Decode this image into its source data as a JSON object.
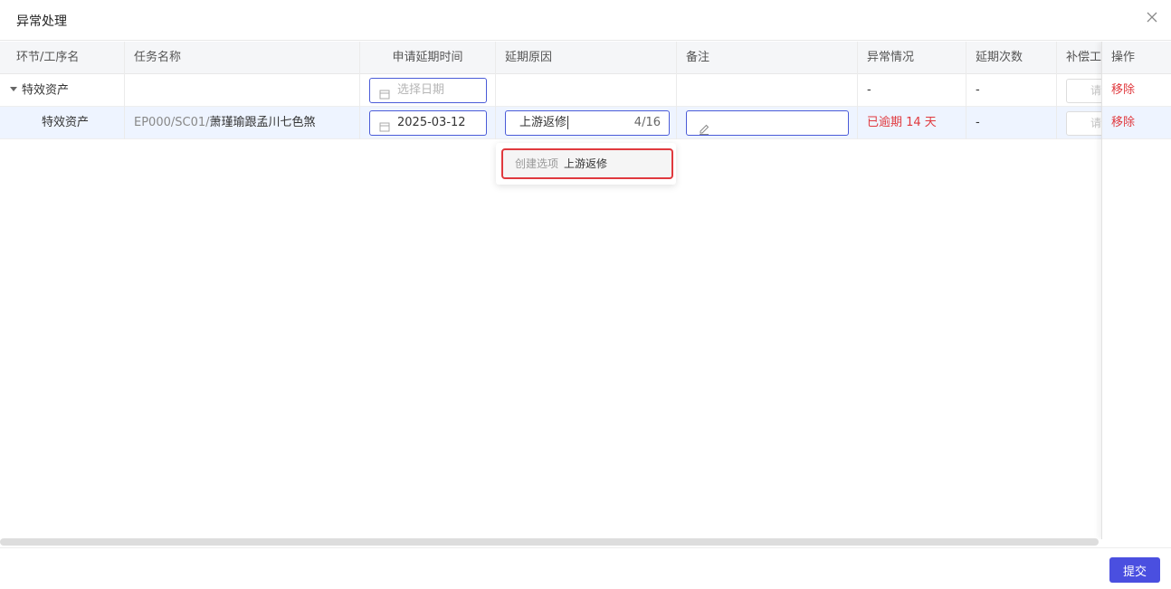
{
  "dialog": {
    "title": "异常处理",
    "submit_label": "提交"
  },
  "table": {
    "columns": {
      "stage": "环节/工序名",
      "task_name": "任务名称",
      "apply_delay_time": "申请延期时间",
      "delay_reason": "延期原因",
      "remark": "备注",
      "exception_status": "异常情况",
      "delay_count": "延期次数",
      "compensation": "补偿工时",
      "operation": "操作"
    },
    "rows": [
      {
        "stage": "特效资产",
        "task_name": "",
        "date_placeholder": "选择日期",
        "delay_reason": "",
        "remark": "",
        "exception_status": "-",
        "delay_count": "-",
        "compensation_placeholder": "请输",
        "action": "移除"
      },
      {
        "stage": "特效资产",
        "task_code": "EP000/SC01/",
        "task_title": "萧瑾瑜跟孟川七色煞",
        "date_value": "2025-03-12",
        "delay_reason_value": "上游返修",
        "delay_reason_count": "4/16",
        "remark": "",
        "exception_status": "已逾期 14 天",
        "delay_count": "-",
        "compensation_placeholder": "请输",
        "action": "移除"
      }
    ]
  },
  "dropdown": {
    "prefix": "创建选项",
    "value": "上游返修"
  },
  "colors": {
    "accent": "#4a4fe0",
    "danger": "#e0393e",
    "row_highlight": "#eef4ff"
  }
}
